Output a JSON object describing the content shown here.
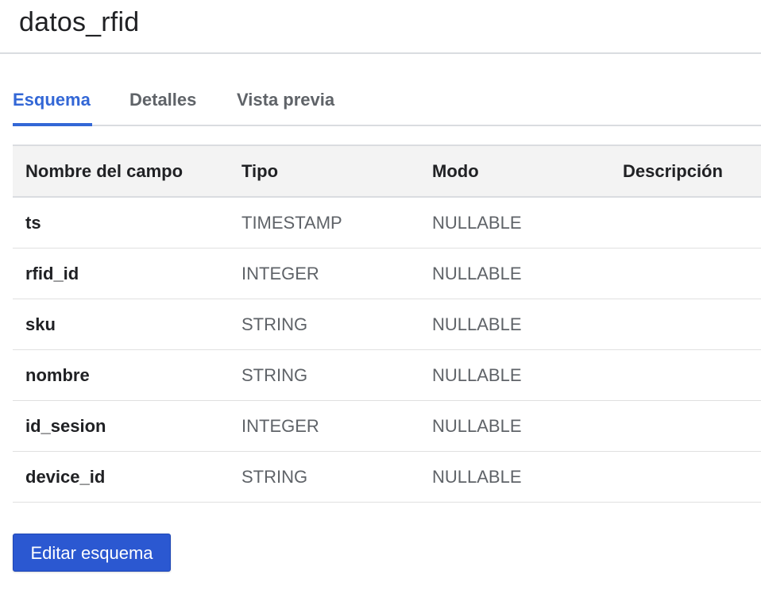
{
  "header": {
    "title": "datos_rfid"
  },
  "tabs": [
    {
      "label": "Esquema",
      "active": true
    },
    {
      "label": "Detalles",
      "active": false
    },
    {
      "label": "Vista previa",
      "active": false
    }
  ],
  "table": {
    "columns": [
      "Nombre del campo",
      "Tipo",
      "Modo",
      "Descripción"
    ],
    "rows": [
      {
        "name": "ts",
        "type": "TIMESTAMP",
        "mode": "NULLABLE",
        "description": ""
      },
      {
        "name": "rfid_id",
        "type": "INTEGER",
        "mode": "NULLABLE",
        "description": ""
      },
      {
        "name": "sku",
        "type": "STRING",
        "mode": "NULLABLE",
        "description": ""
      },
      {
        "name": "nombre",
        "type": "STRING",
        "mode": "NULLABLE",
        "description": ""
      },
      {
        "name": "id_sesion",
        "type": "INTEGER",
        "mode": "NULLABLE",
        "description": ""
      },
      {
        "name": "device_id",
        "type": "STRING",
        "mode": "NULLABLE",
        "description": ""
      }
    ]
  },
  "actions": {
    "edit_schema_label": "Editar esquema"
  },
  "colors": {
    "accent": "#3367d6",
    "button": "#2b58d1",
    "header_bg": "#f3f3f3",
    "divider": "#dadce0"
  }
}
